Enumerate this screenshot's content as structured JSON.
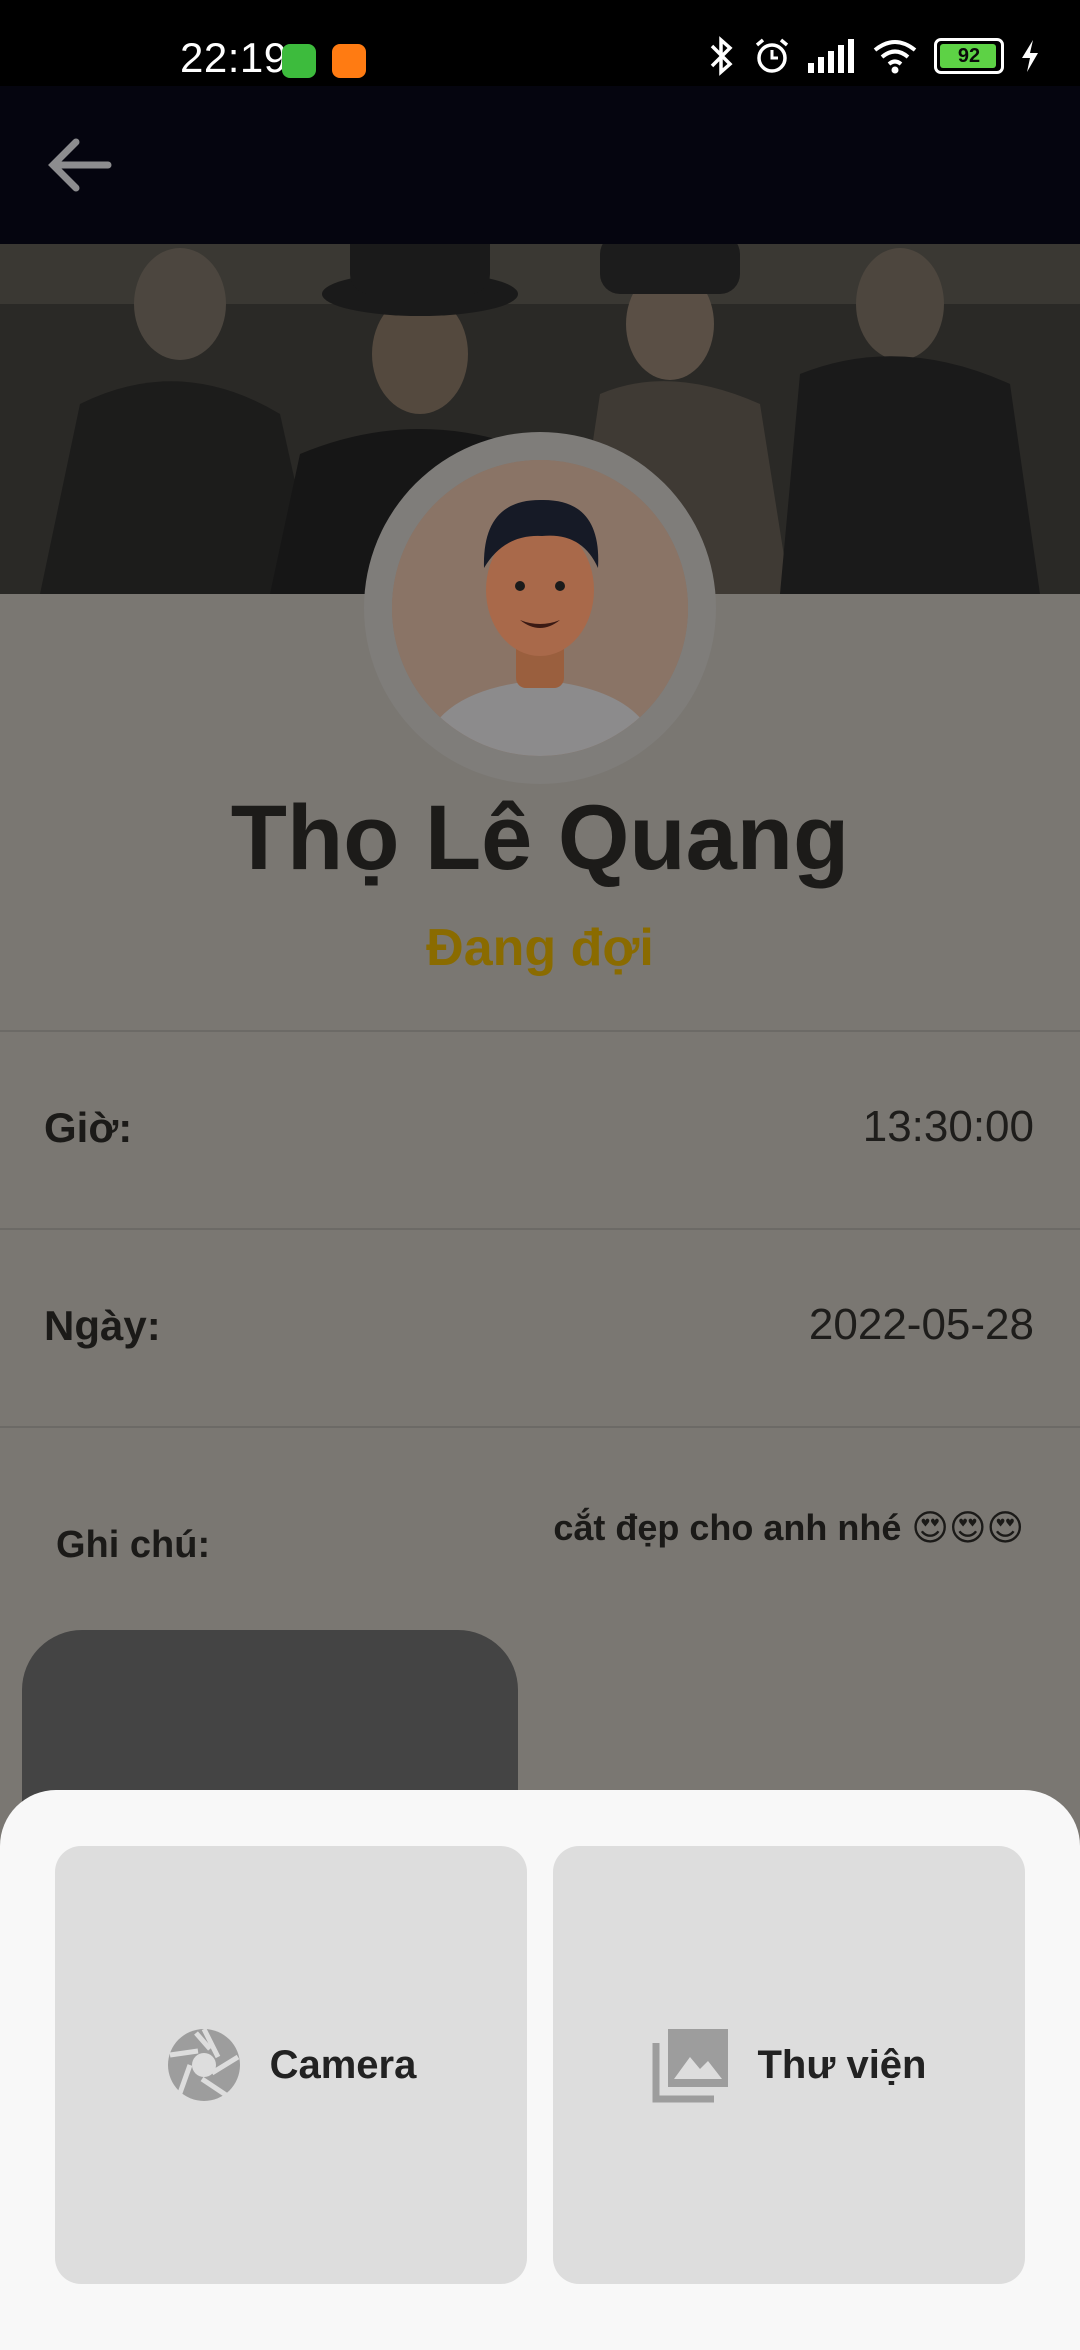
{
  "status_bar": {
    "time": "22:19",
    "battery": "92",
    "icons": [
      "bluetooth-icon",
      "alarm-icon",
      "signal-icon",
      "wifi-icon",
      "battery-icon",
      "charging-icon"
    ]
  },
  "appbar": {
    "back_icon": "arrow-left-icon"
  },
  "profile": {
    "name": "Thọ Lê Quang",
    "status": "Đang đợi"
  },
  "details": {
    "time_label": "Giờ:",
    "time_value": "13:30:00",
    "date_label": "Ngày:",
    "date_value": "2022-05-28",
    "note_label": "Ghi chú:",
    "note_value": "cắt đẹp cho anh nhé 😍😍😍"
  },
  "picker": {
    "camera_label": "Camera",
    "library_label": "Thư viện",
    "camera_icon": "camera-aperture-icon",
    "library_icon": "photo-library-icon"
  },
  "colors": {
    "status_accent": "#8a6b00",
    "sheet_bg": "#f8f8f8",
    "option_bg": "#dddddd"
  }
}
